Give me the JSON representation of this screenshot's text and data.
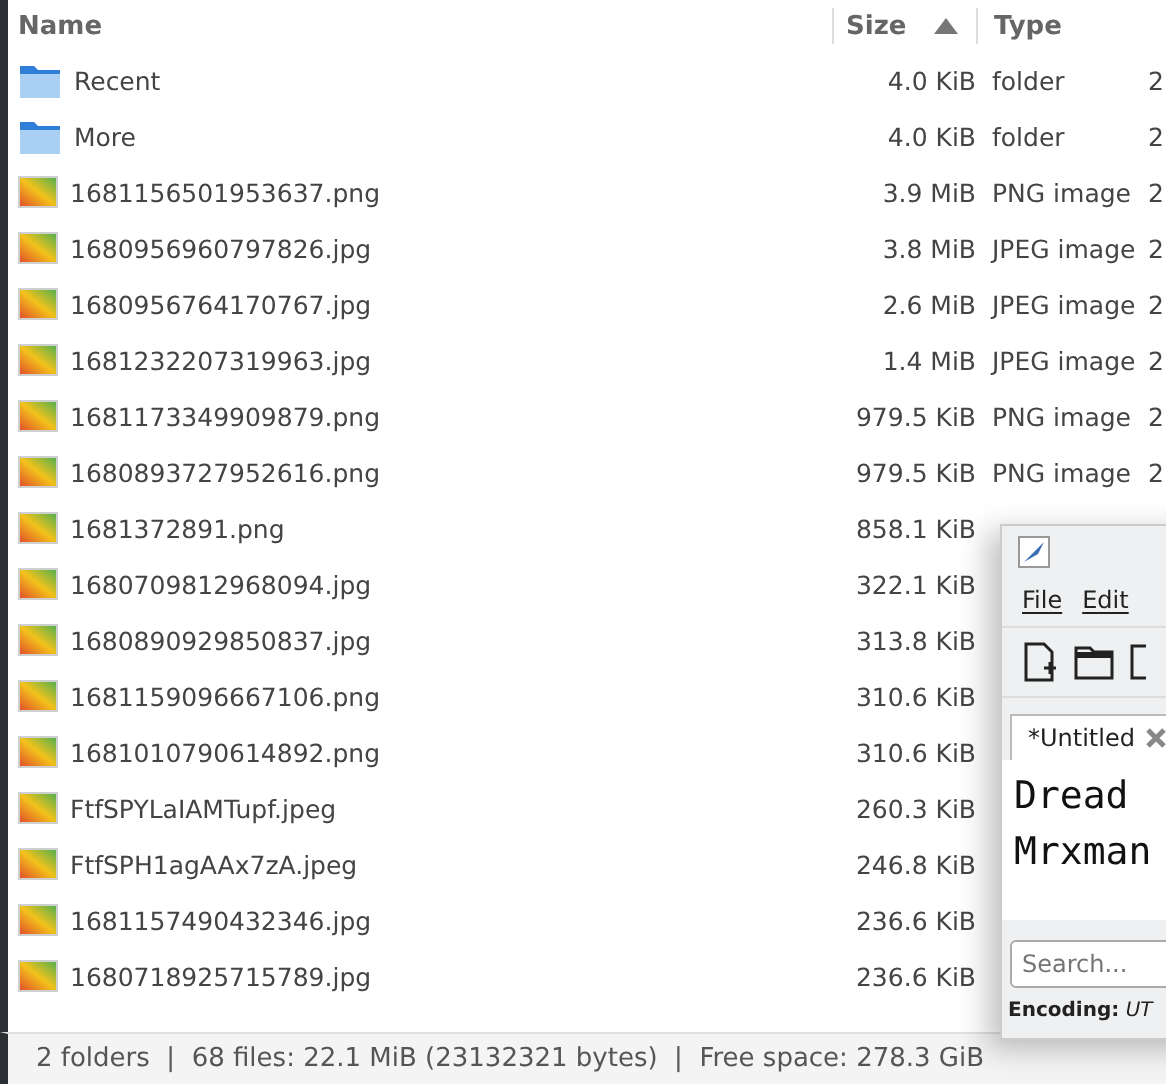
{
  "columns": [
    {
      "label": "Name",
      "sorted": false
    },
    {
      "label": "Size",
      "sorted": true
    },
    {
      "label": "Type",
      "sorted": false
    }
  ],
  "rows": [
    {
      "kind": "folder",
      "name": "Recent",
      "size": "4.0 KiB",
      "type": "folder",
      "column_4": "2"
    },
    {
      "kind": "folder",
      "name": "More",
      "size": "4.0 KiB",
      "type": "folder",
      "column_4": "2"
    },
    {
      "kind": "image",
      "name": "1681156501953637.png",
      "size": "3.9 MiB",
      "type": "PNG image",
      "column_4": "2"
    },
    {
      "kind": "image",
      "name": "1680956960797826.jpg",
      "size": "3.8 MiB",
      "type": "JPEG image",
      "column_4": "2"
    },
    {
      "kind": "image",
      "name": "1680956764170767.jpg",
      "size": "2.6 MiB",
      "type": "JPEG image",
      "column_4": "2"
    },
    {
      "kind": "image",
      "name": "1681232207319963.jpg",
      "size": "1.4 MiB",
      "type": "JPEG image",
      "column_4": "2"
    },
    {
      "kind": "image",
      "name": "1681173349909879.png",
      "size": "979.5 KiB",
      "type": "PNG image",
      "column_4": "2"
    },
    {
      "kind": "image",
      "name": "1680893727952616.png",
      "size": "979.5 KiB",
      "type": "PNG image",
      "column_4": "2"
    },
    {
      "kind": "image",
      "name": "1681372891.png",
      "size": "858.1 KiB"
    },
    {
      "kind": "image",
      "name": "1680709812968094.jpg",
      "size": "322.1 KiB"
    },
    {
      "kind": "image",
      "name": "1680890929850837.jpg",
      "size": "313.8 KiB"
    },
    {
      "kind": "image",
      "name": "1681159096667106.png",
      "size": "310.6 KiB"
    },
    {
      "kind": "image",
      "name": "1681010790614892.png",
      "size": "310.6 KiB"
    },
    {
      "kind": "image",
      "name": "FtfSPYLaIAMTupf.jpeg",
      "size": "260.3 KiB"
    },
    {
      "kind": "image",
      "name": "FtfSPH1agAAx7zA.jpeg",
      "size": "246.8 KiB"
    },
    {
      "kind": "image",
      "name": "1681157490432346.jpg",
      "size": "236.6 KiB"
    },
    {
      "kind": "image",
      "name": "1680718925715789.jpg",
      "size": "236.6 KiB"
    }
  ],
  "status_bar": "2 folders  |  68 files: 22.1 MiB (23132321 bytes)  |  Free space: 278.3 GiB",
  "editor": {
    "menu": [
      "File",
      "Edit"
    ],
    "tabs": [
      {
        "label": "*Untitled",
        "selected": true
      }
    ],
    "text_lines": [
      "Dread",
      "Mrxman"
    ],
    "search": {
      "placeholder": "Search..."
    },
    "encoding_label": "Encoding:",
    "encoding_value": "UT"
  }
}
